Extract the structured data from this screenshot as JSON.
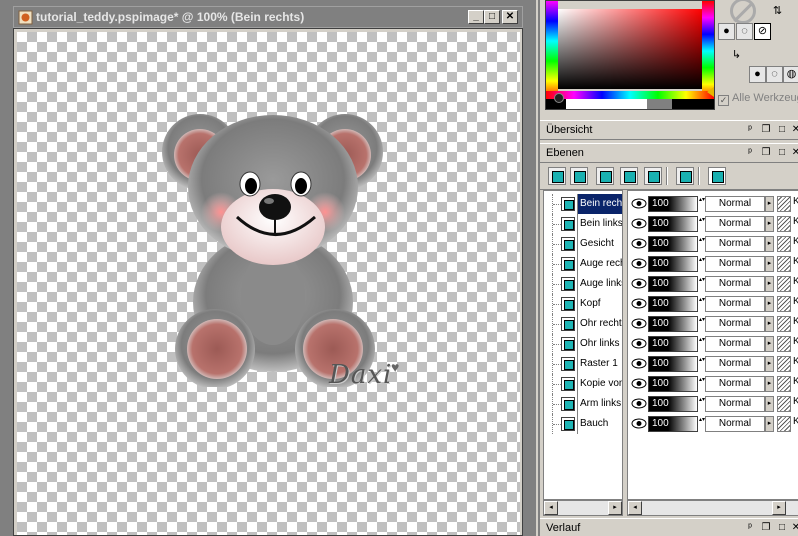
{
  "document": {
    "title": "tutorial_teddy.pspimage* @ 100% (Bein rechts)",
    "controls": {
      "minimize": "_",
      "maximize": "□",
      "close": "✕"
    },
    "signature": "Daxi",
    "signature_heart": "♥"
  },
  "materials": {
    "all_tools_label": "Alle Werkzeuge",
    "all_tools_checked": true,
    "check_mark": "✓"
  },
  "palettes": {
    "overview": "Übersicht",
    "layers": "Ebenen",
    "gradient": "Verlauf",
    "controls": {
      "pin": "ᵖ",
      "restore": "❐",
      "minimize": "□",
      "close": "✕"
    }
  },
  "layers": [
    {
      "name": "Bein rechts",
      "opacity": "100",
      "blend": "Normal",
      "active": true
    },
    {
      "name": "Bein links",
      "opacity": "100",
      "blend": "Normal",
      "active": false
    },
    {
      "name": "Gesicht",
      "opacity": "100",
      "blend": "Normal",
      "active": false
    },
    {
      "name": "Auge rechts",
      "opacity": "100",
      "blend": "Normal",
      "active": false
    },
    {
      "name": "Auge links",
      "opacity": "100",
      "blend": "Normal",
      "active": false
    },
    {
      "name": "Kopf",
      "opacity": "100",
      "blend": "Normal",
      "active": false
    },
    {
      "name": "Ohr rechts",
      "opacity": "100",
      "blend": "Normal",
      "active": false
    },
    {
      "name": "Ohr links",
      "opacity": "100",
      "blend": "Normal",
      "active": false
    },
    {
      "name": "Raster 1",
      "opacity": "100",
      "blend": "Normal",
      "active": false
    },
    {
      "name": "Kopie von",
      "opacity": "100",
      "blend": "Normal",
      "active": false
    },
    {
      "name": "Arm links",
      "opacity": "100",
      "blend": "Normal",
      "active": false
    },
    {
      "name": "Bauch",
      "opacity": "100",
      "blend": "Normal",
      "active": false
    }
  ],
  "layer_row_extra": "K",
  "icons": {
    "eye": "eye-icon",
    "blend_dropdown": "▸",
    "scroll_left": "◂",
    "scroll_right": "▸",
    "spin": "▴▾"
  }
}
